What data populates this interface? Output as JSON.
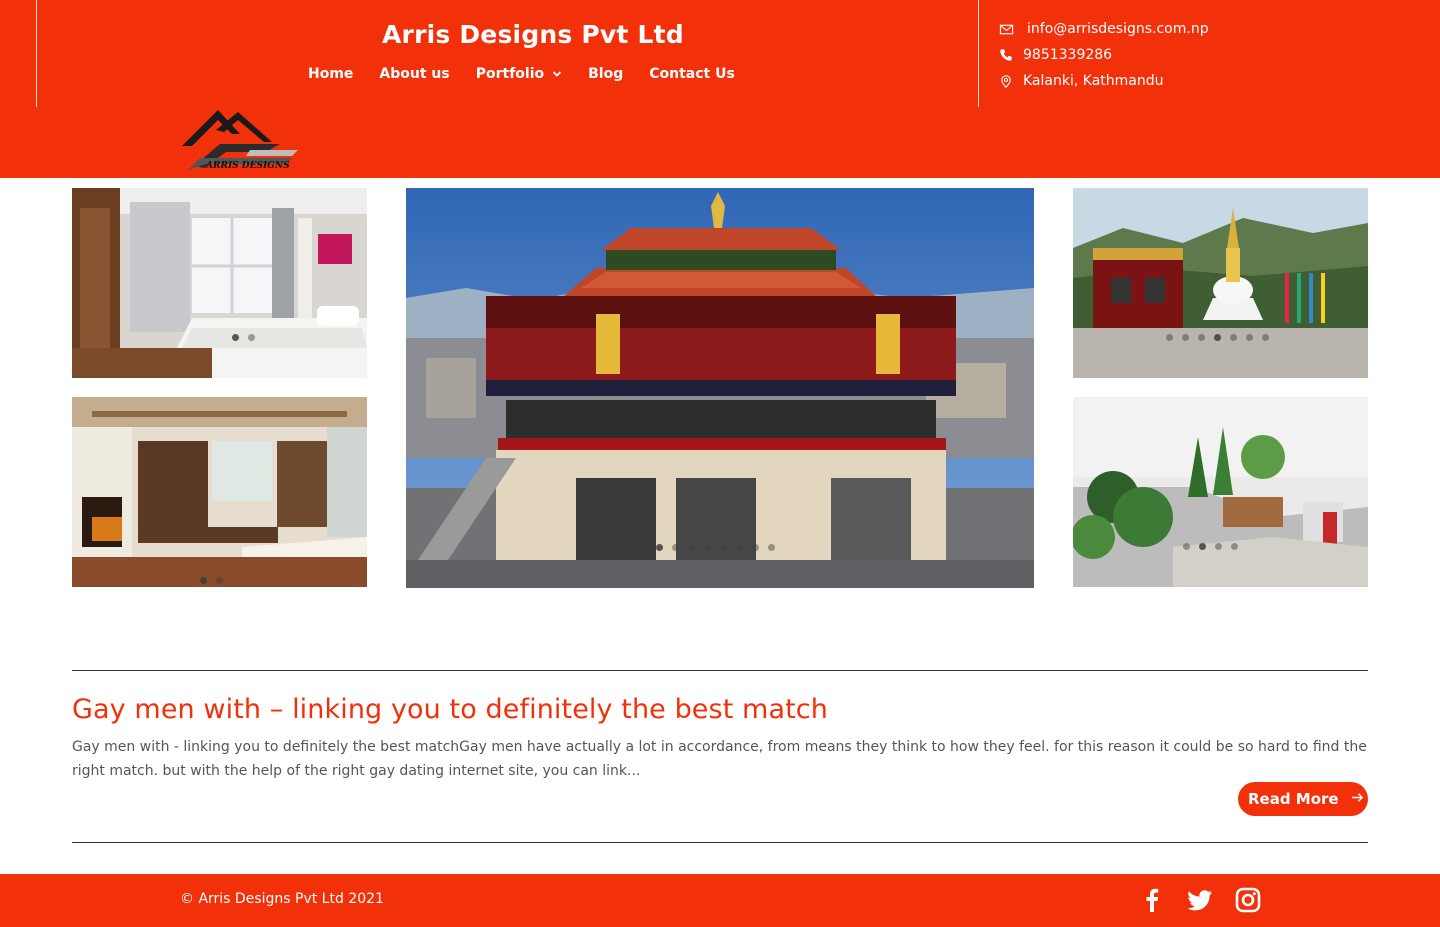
{
  "header": {
    "title": "Arris Designs Pvt Ltd",
    "nav": [
      {
        "label": "Home"
      },
      {
        "label": "About us"
      },
      {
        "label": "Portfolio"
      },
      {
        "label": "Blog"
      },
      {
        "label": "Contact Us"
      }
    ],
    "contact": {
      "email": "info@arrisdesigns.com.np",
      "phone": "9851339286",
      "address": "Kalanki, Kathmandu"
    },
    "logo_text": "ARRIS DESIGNS"
  },
  "gallery": {
    "tiles": [
      {
        "subject": "bedroom interior"
      },
      {
        "subject": "monastery building"
      },
      {
        "subject": "stupa site"
      },
      {
        "subject": "living room interior"
      },
      {
        "subject": "park landscape"
      }
    ]
  },
  "post": {
    "title": "Gay men with – linking you to definitely the best match",
    "excerpt": "Gay men with - linking you to definitely the best matchGay men have actually a lot in accordance, from means they think to how they feel. for this reason it could be so hard to find the right match. but with the help of the right gay dating internet site, you can link...",
    "read_more": "Read More"
  },
  "footer": {
    "copyright": "© Arris Designs Pvt Ltd 2021",
    "social": [
      "facebook-icon",
      "twitter-icon",
      "instagram-icon"
    ]
  },
  "colors": {
    "accent": "#f2300a",
    "text": "#666666"
  }
}
